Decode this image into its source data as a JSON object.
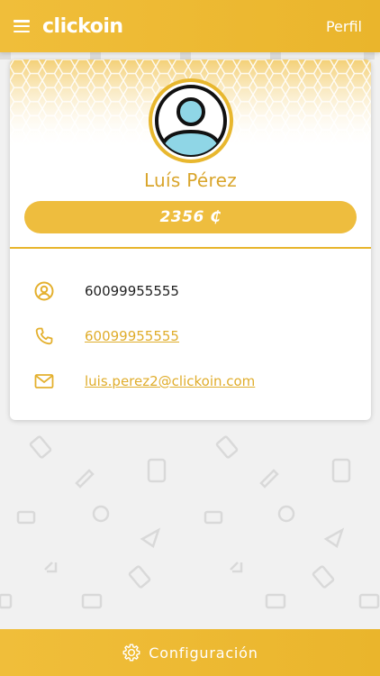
{
  "header": {
    "logo": "clickoin",
    "right_label": "Perfil"
  },
  "profile": {
    "name": "Luís Pérez",
    "balance": "2356 ₵"
  },
  "contacts": [
    {
      "icon": "user-circle-icon",
      "value": "60099955555",
      "link": false
    },
    {
      "icon": "phone-icon",
      "value": "60099955555",
      "link": true
    },
    {
      "icon": "mail-icon",
      "value": "luis.perez2@clickoin.com",
      "link": true
    }
  ],
  "footer": {
    "label": "Configuración",
    "icon": "gear-icon"
  },
  "colors": {
    "accent": "#eebd3e",
    "accent_text": "#d9a52b",
    "background": "#f1f1f1"
  }
}
